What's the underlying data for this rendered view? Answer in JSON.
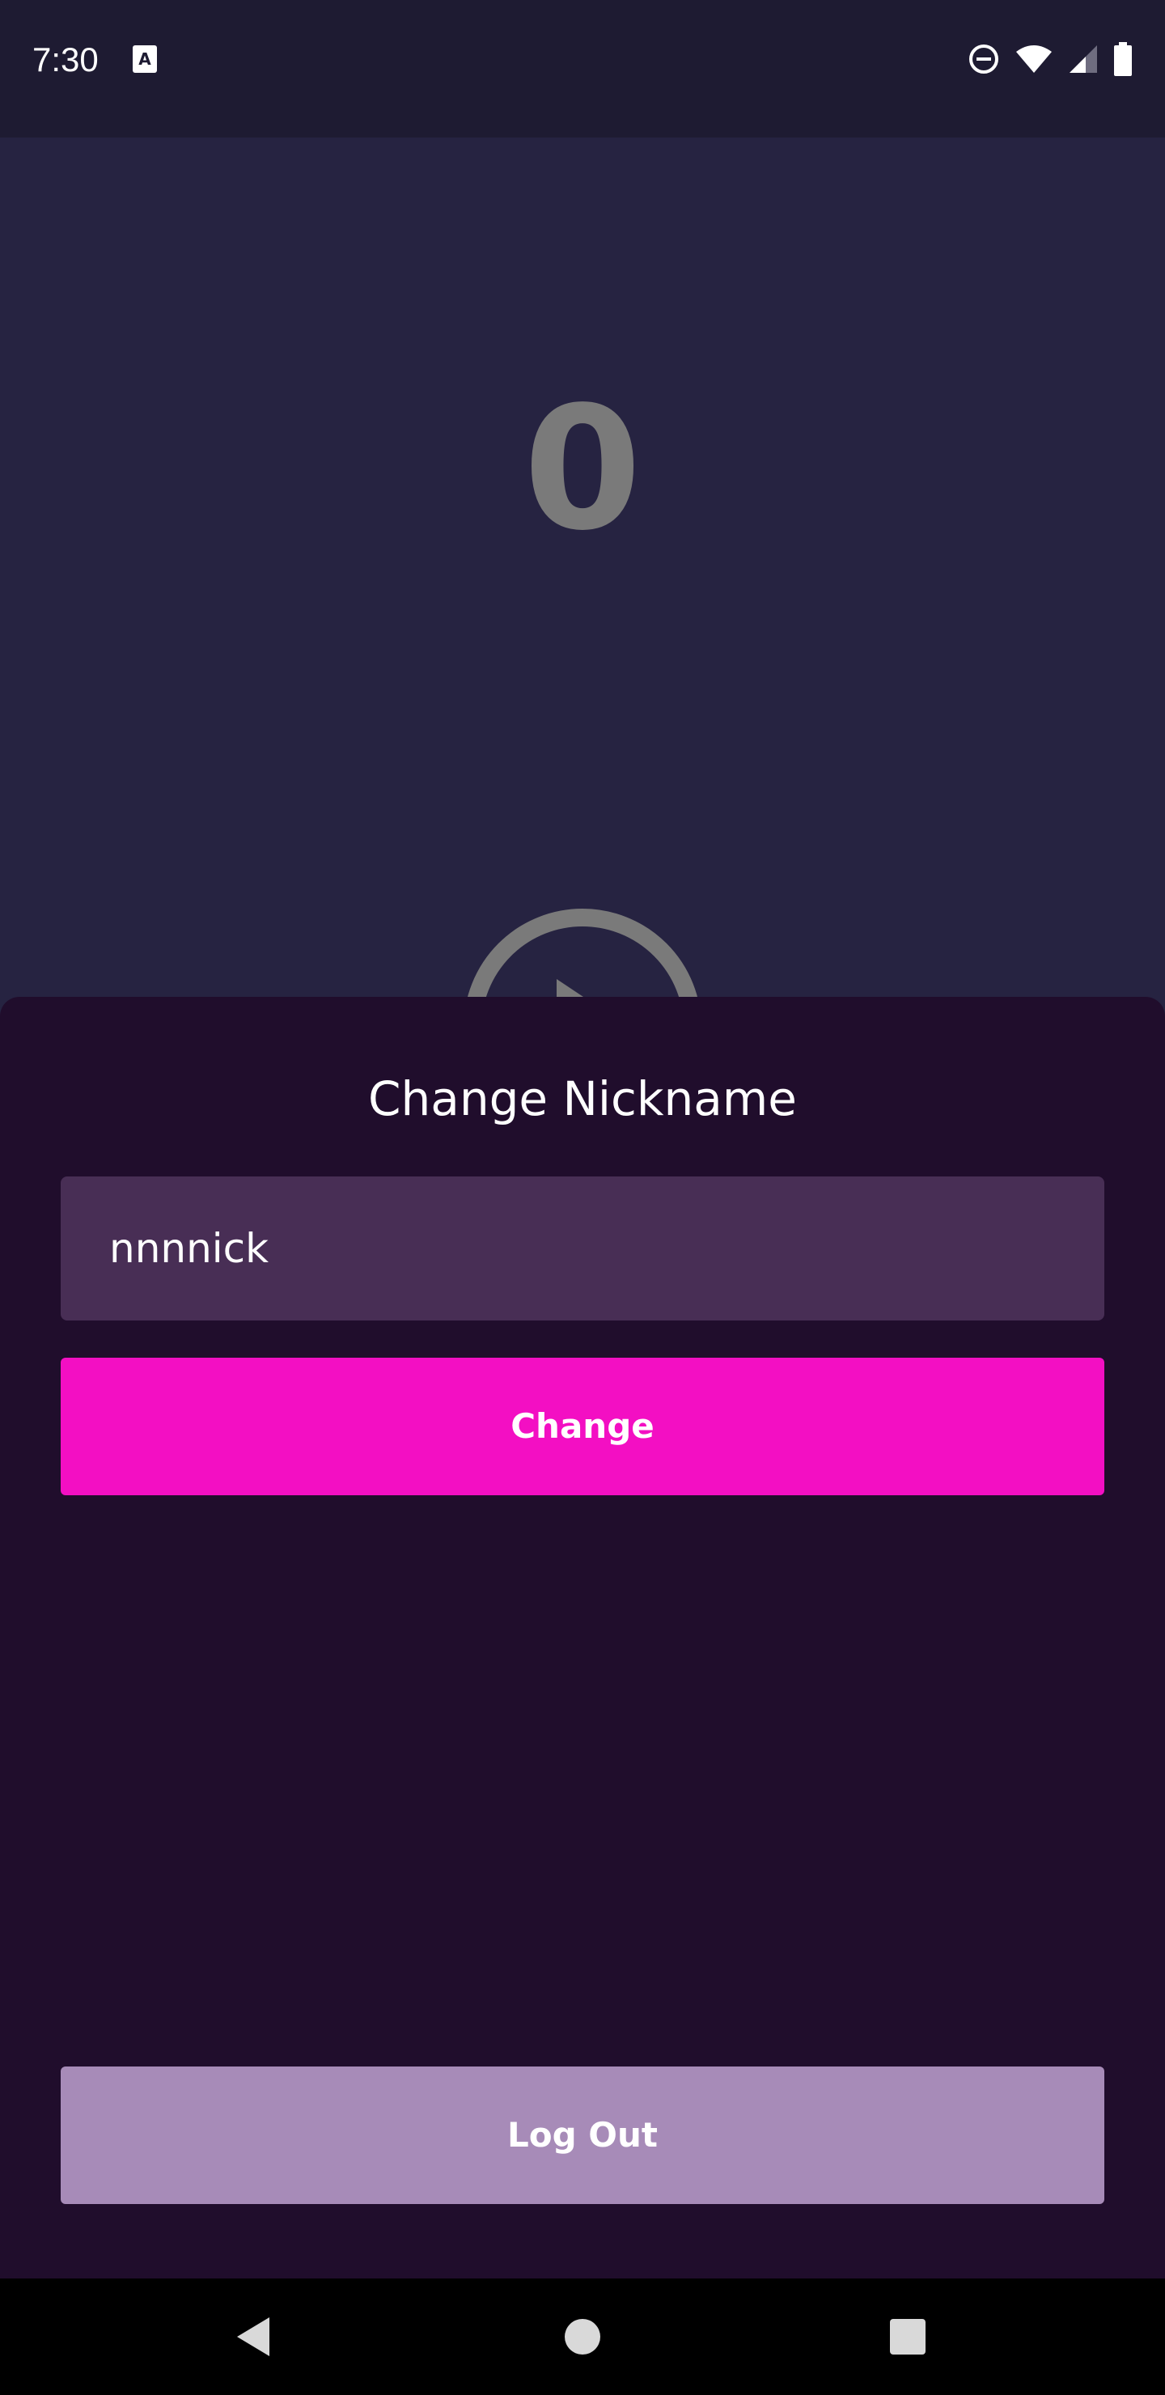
{
  "status_bar": {
    "time": "7:30",
    "icons": [
      "notification-a-icon",
      "do-not-disturb-icon",
      "wifi-icon",
      "cell-signal-icon",
      "battery-icon"
    ]
  },
  "game": {
    "counter": "0",
    "play_icon": "play-circle-icon"
  },
  "sheet": {
    "title": "Change Nickname",
    "nickname_value": "nnnnick",
    "change_label": "Change",
    "logout_label": "Log Out"
  },
  "nav_bar": {
    "icons": [
      "back-icon",
      "home-icon",
      "recents-icon"
    ]
  },
  "colors": {
    "background": "#262341",
    "status_bar": "#1e1b32",
    "sheet": "#200d2c",
    "input": "#482e55",
    "accent": "#f30fc3",
    "logout": "#a78bb8",
    "counter": "#7a7a7a"
  }
}
